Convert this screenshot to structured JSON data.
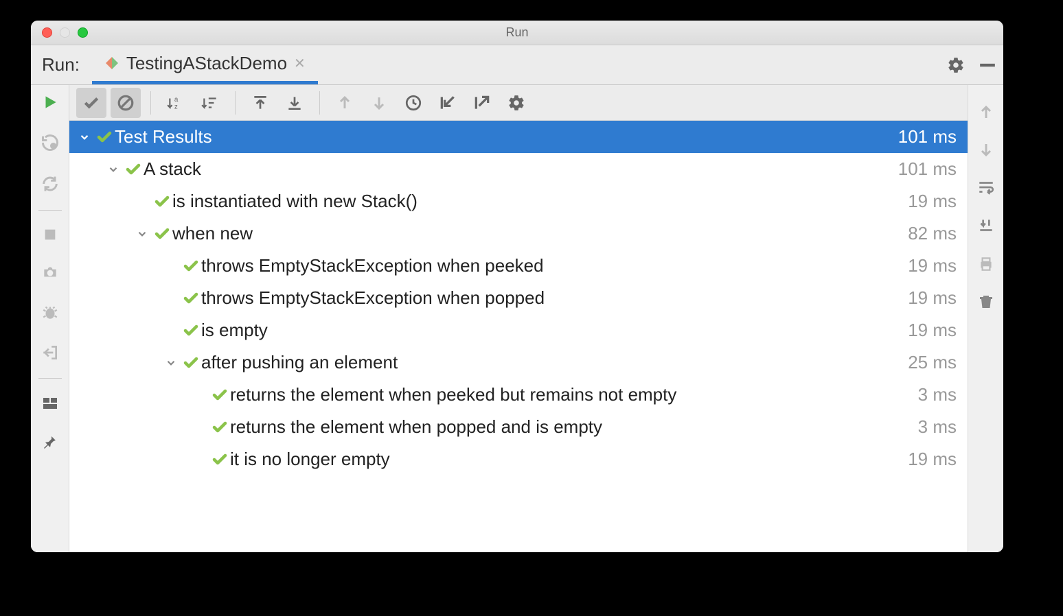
{
  "window": {
    "title": "Run"
  },
  "tabbar": {
    "label": "Run:",
    "tab_name": "TestingAStackDemo"
  },
  "tree": [
    {
      "indent": 0,
      "chevron": true,
      "selected": true,
      "label": "Test Results",
      "duration": "101 ms"
    },
    {
      "indent": 1,
      "chevron": true,
      "selected": false,
      "label": "A stack",
      "duration": "101 ms"
    },
    {
      "indent": 2,
      "chevron": false,
      "selected": false,
      "label": "is instantiated with new Stack()",
      "duration": "19 ms"
    },
    {
      "indent": 2,
      "chevron": true,
      "selected": false,
      "label": "when new",
      "duration": "82 ms"
    },
    {
      "indent": 3,
      "chevron": false,
      "selected": false,
      "label": "throws EmptyStackException when peeked",
      "duration": "19 ms"
    },
    {
      "indent": 3,
      "chevron": false,
      "selected": false,
      "label": "throws EmptyStackException when popped",
      "duration": "19 ms"
    },
    {
      "indent": 3,
      "chevron": false,
      "selected": false,
      "label": "is empty",
      "duration": "19 ms"
    },
    {
      "indent": 3,
      "chevron": true,
      "selected": false,
      "label": "after pushing an element",
      "duration": "25 ms"
    },
    {
      "indent": 4,
      "chevron": false,
      "selected": false,
      "label": "returns the element when peeked but remains not empty",
      "duration": "3 ms"
    },
    {
      "indent": 4,
      "chevron": false,
      "selected": false,
      "label": "returns the element when popped and is empty",
      "duration": "3 ms"
    },
    {
      "indent": 4,
      "chevron": false,
      "selected": false,
      "label": "it is no longer empty",
      "duration": "19 ms"
    }
  ]
}
